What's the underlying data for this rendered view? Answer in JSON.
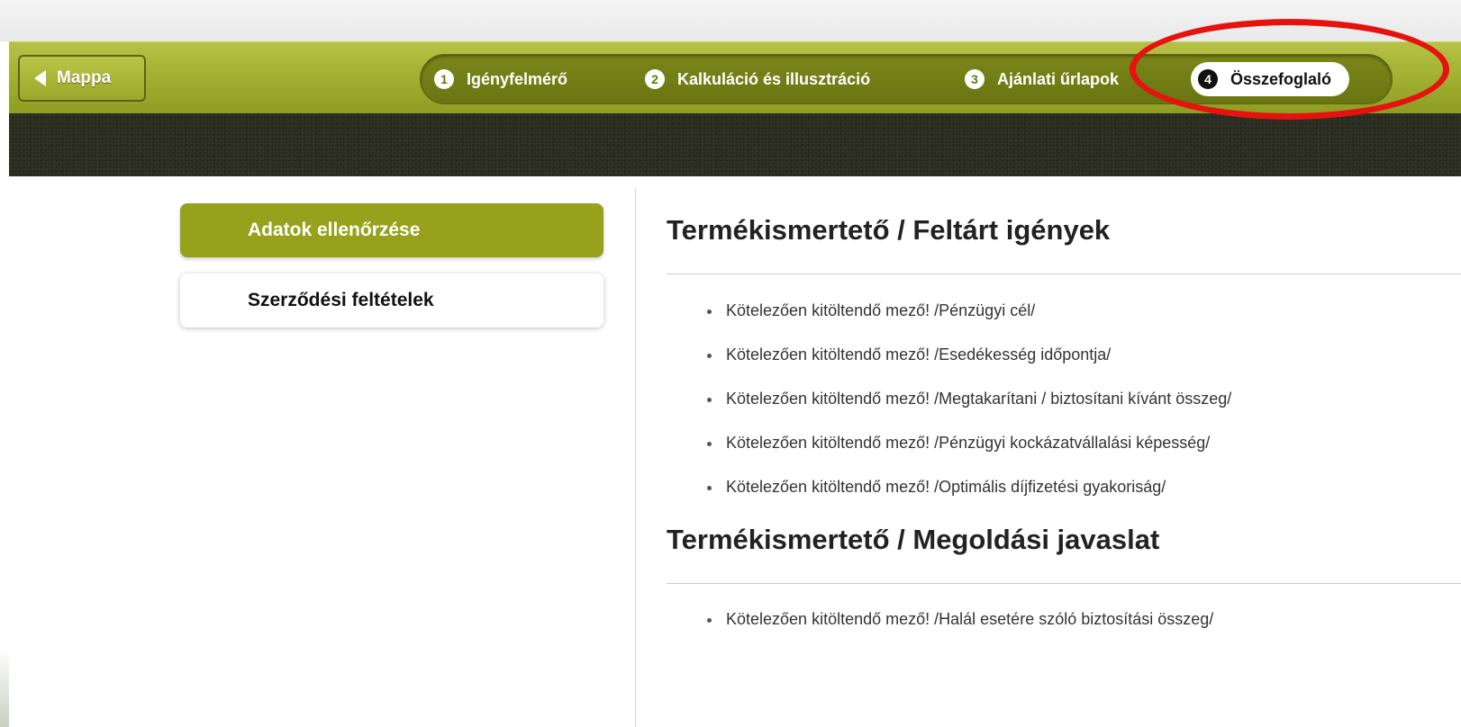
{
  "header": {
    "back_button": {
      "label": "Mappa",
      "icon": "triangle-left-icon"
    },
    "steps": [
      {
        "num": "1",
        "label": "Igényfelmérő"
      },
      {
        "num": "2",
        "label": "Kalkuláció és illusztráció"
      },
      {
        "num": "3",
        "label": "Ajánlati űrlapok"
      },
      {
        "num": "4",
        "label": "Összefoglaló"
      }
    ],
    "active_step": "4",
    "colors": {
      "bar_green": "#a3b232",
      "pill_dark": "#6a7512",
      "band_dark": "#2a2d1f",
      "highlight_red": "#e6120f"
    }
  },
  "sidebar": {
    "items": [
      {
        "label": "Adatok ellenőrzése",
        "active": true
      },
      {
        "label": "Szerződési feltételek",
        "active": false
      }
    ],
    "active_color": "#98a11b"
  },
  "main": {
    "sections": [
      {
        "title": "Termékismertető / Feltárt igények",
        "items": [
          "Kötelezően kitöltendő mező! /Pénzügyi cél/",
          "Kötelezően kitöltendő mező! /Esedékesség időpontja/",
          "Kötelezően kitöltendő mező! /Megtakarítani / biztosítani kívánt összeg/",
          "Kötelezően kitöltendő mező! /Pénzügyi kockázatvállalási képesség/",
          "Kötelezően kitöltendő mező! /Optimális díjfizetési gyakoriság/"
        ]
      },
      {
        "title": "Termékismertető / Megoldási javaslat",
        "items": [
          "Kötelezően kitöltendő mező! /Halál esetére szóló biztosítási összeg/"
        ]
      }
    ]
  }
}
